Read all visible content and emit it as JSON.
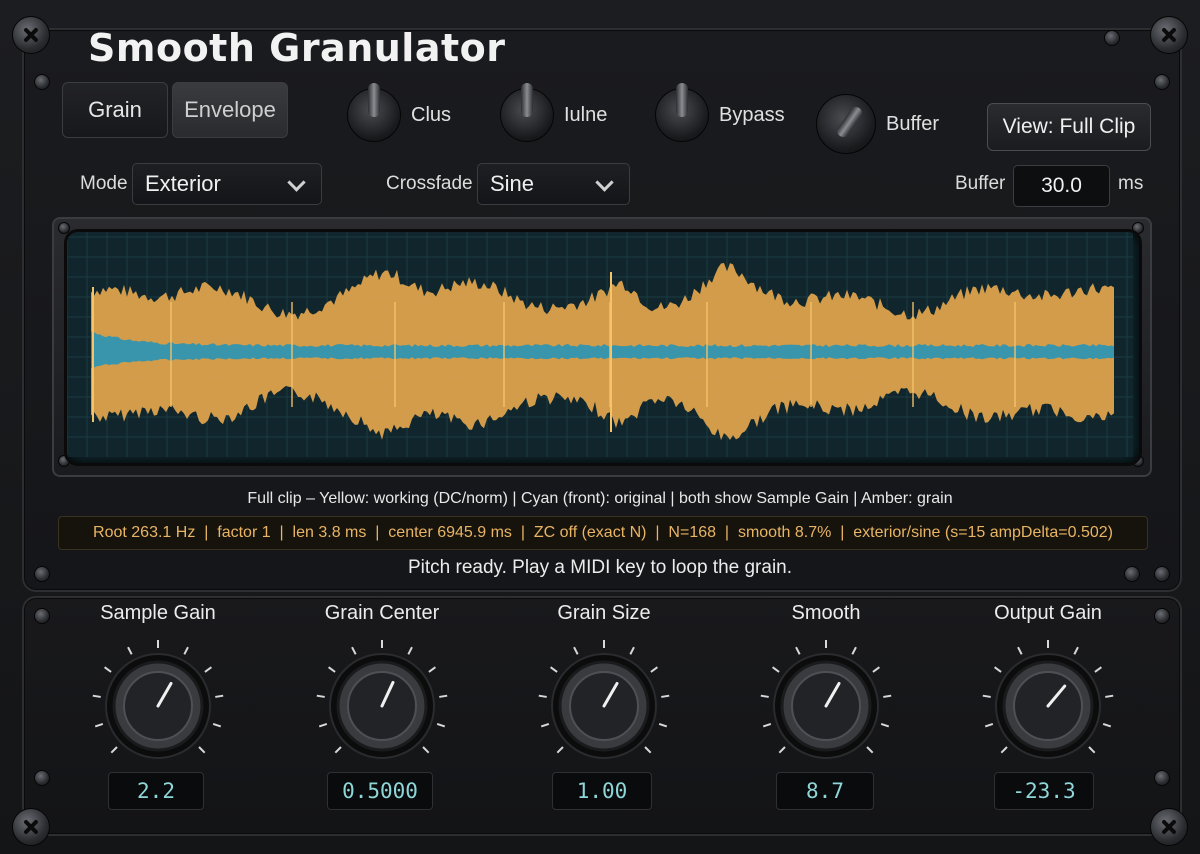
{
  "app": {
    "title": "Smooth Granulator"
  },
  "tabs": [
    {
      "label": "Grain",
      "active": true
    },
    {
      "label": "Envelope",
      "active": false
    }
  ],
  "toggles": [
    {
      "label": "Clus"
    },
    {
      "label": "Iulne"
    },
    {
      "label": "Bypass"
    },
    {
      "label": "Buffer"
    }
  ],
  "view_button": {
    "label": "View: Full Clip"
  },
  "controls": {
    "mode_label": "Mode",
    "mode_value": "Exterior",
    "crossfade_label": "Crossfade",
    "crossfade_value": "Sine",
    "buffer_label": "Buffer",
    "buffer_value": "30.0",
    "buffer_unit": "ms"
  },
  "waveform": {
    "legend": "Full clip – Yellow: working (DC/norm)  |  Cyan (front): original  |  both show Sample Gain  |  Amber: grain",
    "colors": {
      "working": "#e3a64e",
      "original": "#2f95b0",
      "grain": "#f5c46a",
      "background": "#10262c"
    }
  },
  "info_bar": "Root 263.1 Hz  |  factor 1  |  len 3.8 ms  |  center 6945.9 ms  |  ZC off (exact N)  |  N=168  |  smooth 8.7%  |  exterior/sine (s=15 ampDelta=0.502)",
  "status": "Pitch ready. Play a MIDI key to loop the grain.",
  "knobs": [
    {
      "label": "Sample Gain",
      "value": "2.2"
    },
    {
      "label": "Grain Center",
      "value": "0.5000"
    },
    {
      "label": "Grain Size",
      "value": "1.00"
    },
    {
      "label": "Smooth",
      "value": "8.7"
    },
    {
      "label": "Output Gain",
      "value": "-23.3"
    }
  ]
}
